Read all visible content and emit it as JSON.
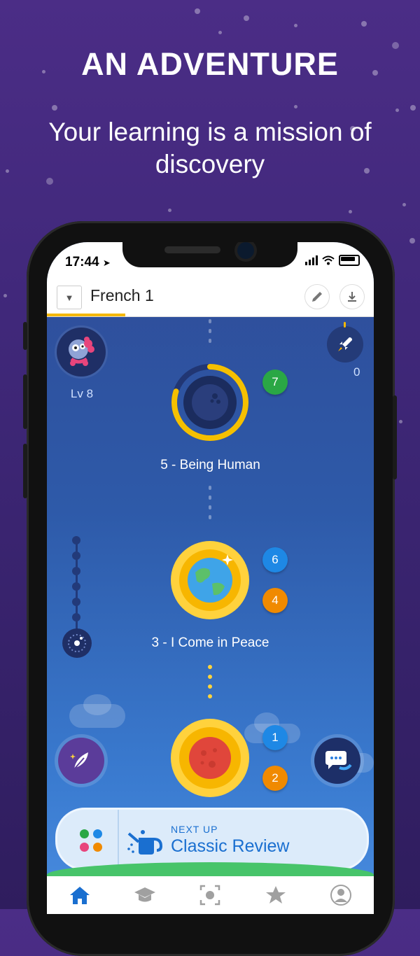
{
  "promo": {
    "headline": "AN ADVENTURE",
    "subline": "Your learning is a mission of discovery"
  },
  "status_bar": {
    "time": "17:44"
  },
  "app_bar": {
    "course_title": "French 1"
  },
  "profile": {
    "level_label": "Lv 8"
  },
  "rocket": {
    "count": "0"
  },
  "levels": [
    {
      "label": "5 - Being Human",
      "badges": [
        "7"
      ],
      "progress": 0.8
    },
    {
      "label": "3 - I Come in Peace",
      "badges": [
        "6",
        "4"
      ]
    },
    {
      "label": "",
      "badges": [
        "1",
        "2"
      ]
    }
  ],
  "next_up": {
    "kicker": "NEXT UP",
    "title": "Classic Review"
  },
  "colors": {
    "accent_yellow": "#f5b800",
    "badge_green": "#2aa745",
    "badge_blue": "#1e88e5",
    "badge_orange": "#f08a00",
    "next_up_blue": "#1a6fd0"
  },
  "icons": {
    "dropdown": "chevron-down-icon",
    "edit": "pencil-icon",
    "download": "download-icon",
    "rocket": "rocket-icon",
    "notes": "feather-icon",
    "chat": "chat-bubble-icon",
    "review": "watering-can-icon",
    "tabs": [
      "home-icon",
      "graduation-cap-icon",
      "scan-icon",
      "star-icon",
      "profile-icon"
    ]
  }
}
